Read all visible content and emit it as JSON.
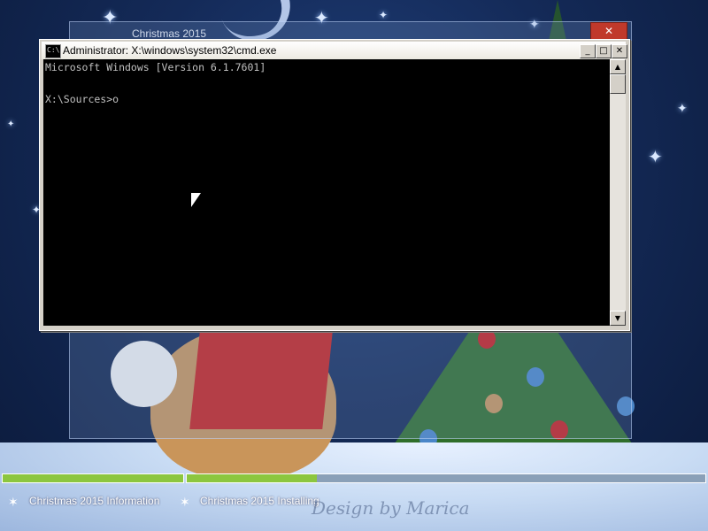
{
  "wallpaper": {
    "colors": {
      "sky": "#142a58",
      "snow": "#c9dcf4",
      "tree": "#2f6e2a",
      "book": "#c9201c",
      "progress_fill": "#8cc63f"
    },
    "watermark": "Design by Marica"
  },
  "background_window": {
    "title": "Christmas 2015",
    "close_icon": "close-icon"
  },
  "cmd_window": {
    "title": "Administrator: X:\\windows\\system32\\cmd.exe",
    "icon": "cmd-icon",
    "icon_text": "C:\\",
    "minimize_glyph": "_",
    "maximize_glyph": "□",
    "close_glyph": "✕",
    "console_lines": [
      "Microsoft Windows [Version 6.1.7601]",
      "",
      "X:\\Sources>o"
    ],
    "scroll_up_glyph": "▲",
    "scroll_down_glyph": "▼"
  },
  "setup_progress": {
    "steps": [
      {
        "label": "Christmas 2015 Information",
        "icon": "star-icon",
        "progress": 1.0
      },
      {
        "label": "Christmas 2015 Installing",
        "icon": "star-icon",
        "progress": 0.25
      }
    ]
  }
}
